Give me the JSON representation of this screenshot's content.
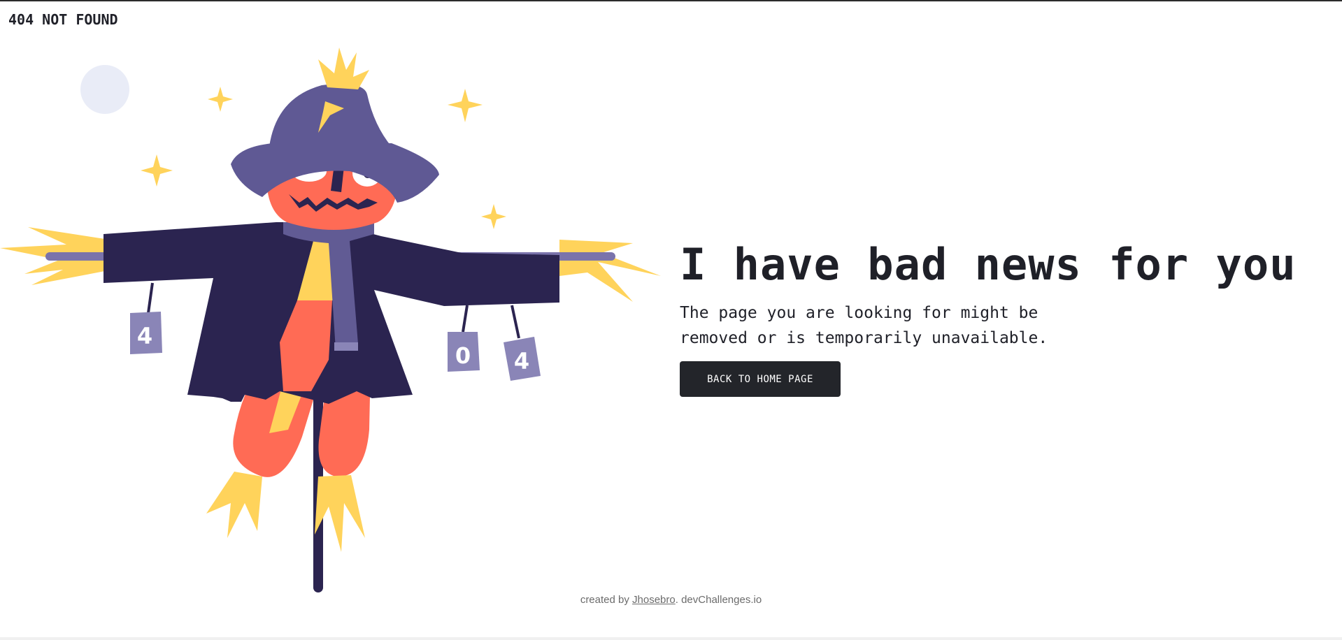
{
  "header": {
    "brand": "404 NOT FOUND"
  },
  "illustration": {
    "cans": [
      "4",
      "0",
      "4"
    ],
    "colors": {
      "moon": "#e9ecf7",
      "hat": "#5f5994",
      "straw": "#ffd35b",
      "head": "#ff6b55",
      "coat": "#2b2450",
      "scarf": "#615b94",
      "can": "#8a85b7",
      "pole": "#2b2450"
    }
  },
  "main": {
    "headline": "I have bad news for you",
    "message": "The page you are looking for might be removed or is temporarily unavailable.",
    "cta_label": "BACK TO HOME PAGE"
  },
  "footer": {
    "prefix": "created by ",
    "author": "Jhosebro",
    "suffix": ". devChallenges.io"
  }
}
